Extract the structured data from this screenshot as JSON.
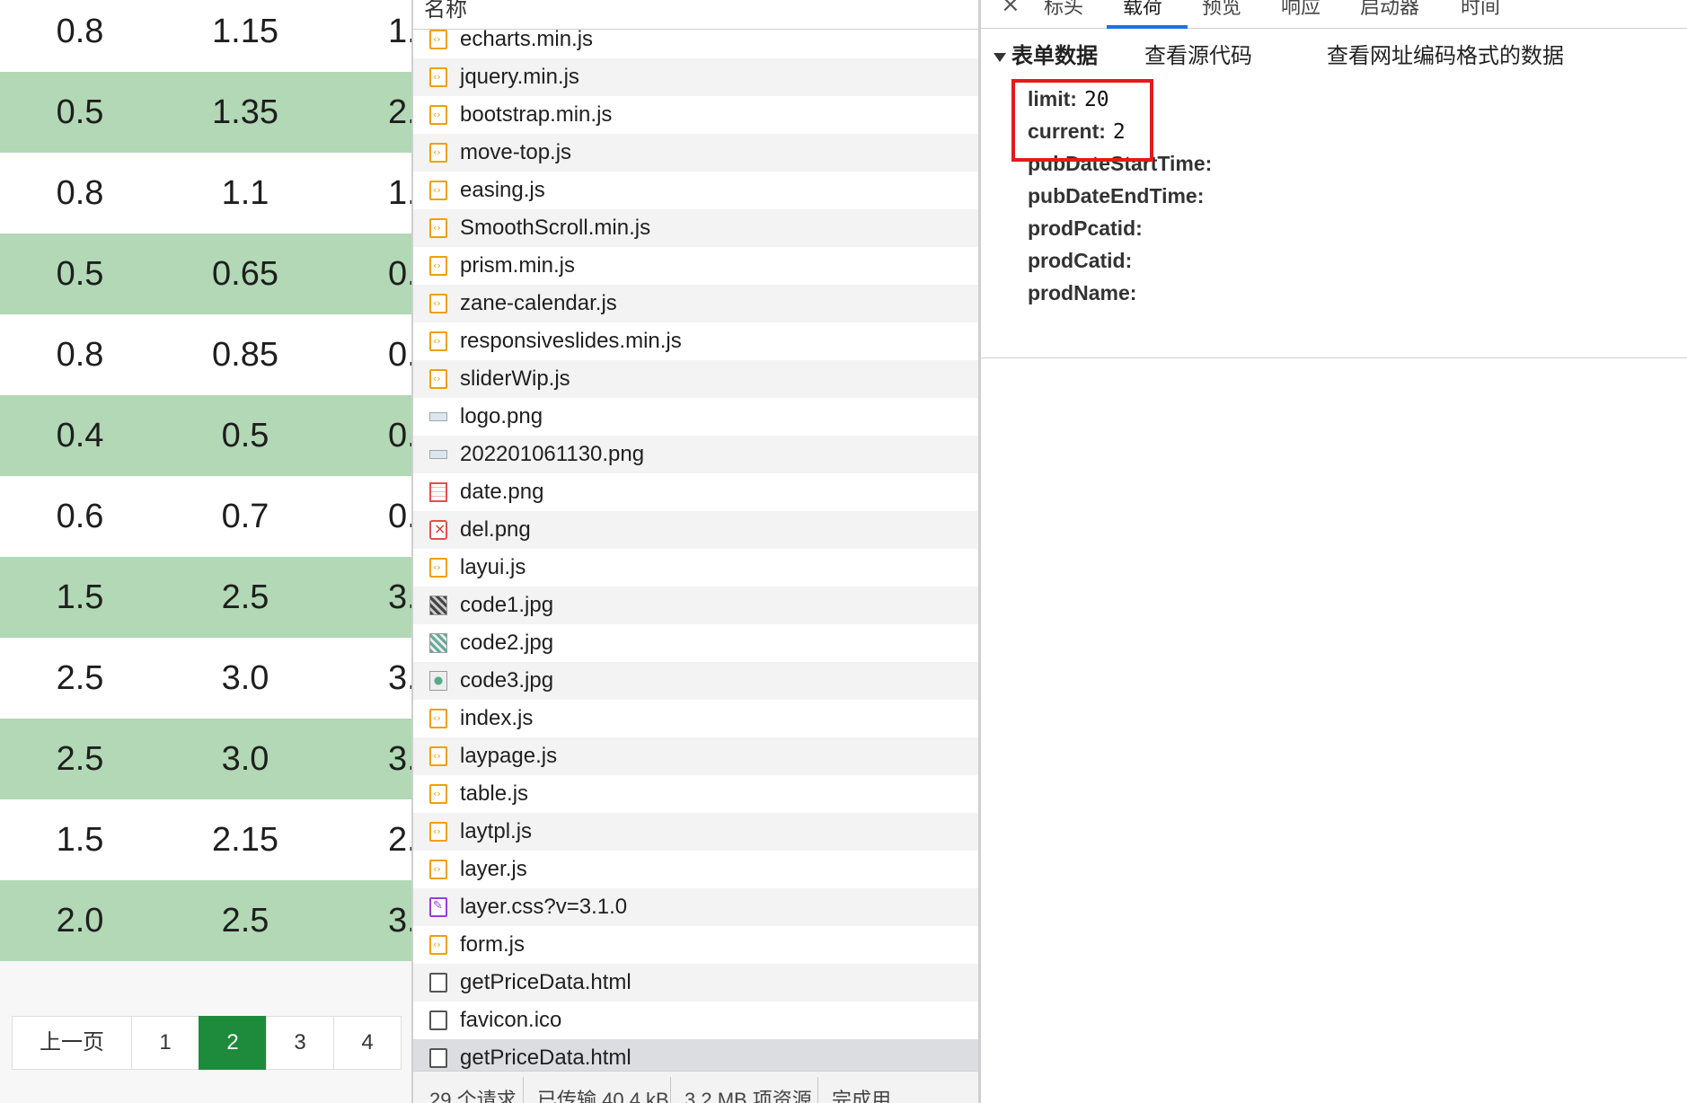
{
  "price_table": {
    "rows": [
      [
        "0.8",
        "1.15",
        "1."
      ],
      [
        "0.5",
        "1.35",
        "2."
      ],
      [
        "0.8",
        "1.1",
        "1."
      ],
      [
        "0.5",
        "0.65",
        "0."
      ],
      [
        "0.8",
        "0.85",
        "0."
      ],
      [
        "0.4",
        "0.5",
        "0."
      ],
      [
        "0.6",
        "0.7",
        "0."
      ],
      [
        "1.5",
        "2.5",
        "3."
      ],
      [
        "2.5",
        "3.0",
        "3."
      ],
      [
        "2.5",
        "3.0",
        "3."
      ],
      [
        "1.5",
        "2.15",
        "2."
      ],
      [
        "2.0",
        "2.5",
        "3."
      ]
    ],
    "row_colors": {
      "even": "#ffffff",
      "odd": "#b2d8b5"
    }
  },
  "pagination": {
    "prev_label": "上一页",
    "pages": [
      "1",
      "2",
      "3",
      "4"
    ],
    "current_page": "2",
    "active_color": "#1e8a3c"
  },
  "network": {
    "column_name": "名称",
    "requests": [
      {
        "name": "echarts.min.js",
        "icon": "script-file-icon"
      },
      {
        "name": "jquery.min.js",
        "icon": "script-file-icon"
      },
      {
        "name": "bootstrap.min.js",
        "icon": "script-file-icon"
      },
      {
        "name": "move-top.js",
        "icon": "script-file-icon"
      },
      {
        "name": "easing.js",
        "icon": "script-file-icon"
      },
      {
        "name": "SmoothScroll.min.js",
        "icon": "script-file-icon"
      },
      {
        "name": "prism.min.js",
        "icon": "script-file-icon"
      },
      {
        "name": "zane-calendar.js",
        "icon": "script-file-icon"
      },
      {
        "name": "responsiveslides.min.js",
        "icon": "script-file-icon"
      },
      {
        "name": "sliderWip.js",
        "icon": "script-file-icon"
      },
      {
        "name": "logo.png",
        "icon": "image-file-icon"
      },
      {
        "name": "202201061130.png",
        "icon": "image-file-icon"
      },
      {
        "name": "date.png",
        "icon": "calendar-image-icon"
      },
      {
        "name": "del.png",
        "icon": "delete-image-icon"
      },
      {
        "name": "layui.js",
        "icon": "script-file-icon"
      },
      {
        "name": "code1.jpg",
        "icon": "qr-image-icon"
      },
      {
        "name": "code2.jpg",
        "icon": "qr-image-icon"
      },
      {
        "name": "code3.jpg",
        "icon": "qr-image-icon"
      },
      {
        "name": "index.js",
        "icon": "script-file-icon"
      },
      {
        "name": "laypage.js",
        "icon": "script-file-icon"
      },
      {
        "name": "table.js",
        "icon": "script-file-icon"
      },
      {
        "name": "laytpl.js",
        "icon": "script-file-icon"
      },
      {
        "name": "layer.js",
        "icon": "script-file-icon"
      },
      {
        "name": "layer.css?v=3.1.0",
        "icon": "stylesheet-file-icon"
      },
      {
        "name": "form.js",
        "icon": "script-file-icon"
      },
      {
        "name": "getPriceData.html",
        "icon": "document-file-icon"
      },
      {
        "name": "favicon.ico",
        "icon": "document-file-icon"
      },
      {
        "name": "getPriceData.html",
        "icon": "document-file-icon",
        "selected": true
      }
    ],
    "status": {
      "requests": "29 个请求",
      "transferred": "已传输 40.4 kB",
      "resources": "3.2 MB 项资源",
      "finish": "完成用"
    }
  },
  "payload": {
    "tabs": [
      "标头",
      "载荷",
      "预览",
      "响应",
      "启动器",
      "时间"
    ],
    "active_tab": "载荷",
    "form_title": "表单数据",
    "view_source": "查看源代码",
    "view_url_encoded": "查看网址编码格式的数据",
    "params": [
      {
        "key": "limit:",
        "value": "20"
      },
      {
        "key": "current:",
        "value": "2"
      },
      {
        "key": "pubDateStartTime:",
        "value": ""
      },
      {
        "key": "pubDateEndTime:",
        "value": ""
      },
      {
        "key": "prodPcatid:",
        "value": ""
      },
      {
        "key": "prodCatid:",
        "value": ""
      },
      {
        "key": "prodName:",
        "value": ""
      }
    ],
    "highlight_color": "#e31b1b",
    "accent_color": "#1a73e8"
  }
}
